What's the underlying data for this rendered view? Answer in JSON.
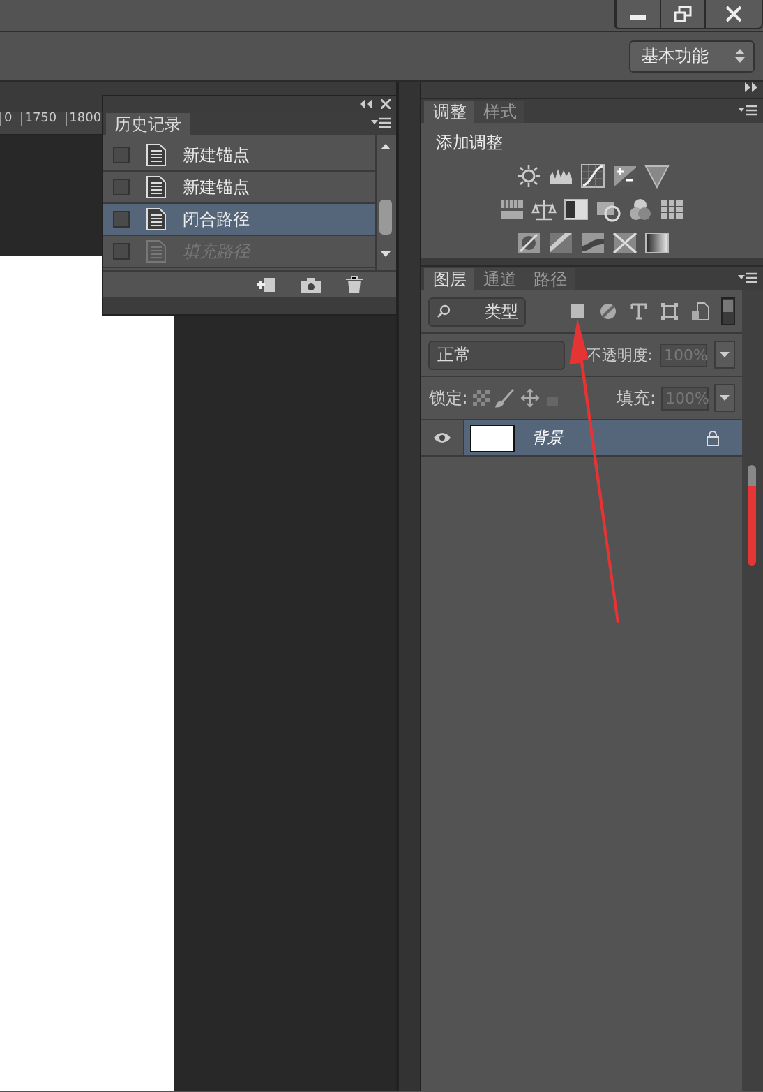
{
  "workspace_menu": {
    "value": "基本功能"
  },
  "ruler": {
    "labels": [
      "0",
      "1750",
      "1800"
    ]
  },
  "history": {
    "title": "历史记录",
    "items": [
      {
        "label": "新建锚点",
        "selected": false,
        "disabled": false
      },
      {
        "label": "新建锚点",
        "selected": false,
        "disabled": false
      },
      {
        "label": "闭合路径",
        "selected": true,
        "disabled": false
      },
      {
        "label": "填充路径",
        "selected": false,
        "disabled": true
      }
    ]
  },
  "adjustments": {
    "tabs": [
      {
        "label": "调整",
        "selected": true
      },
      {
        "label": "样式",
        "selected": false
      }
    ],
    "heading": "添加调整"
  },
  "layers": {
    "tabs": [
      {
        "label": "图层",
        "selected": true
      },
      {
        "label": "通道",
        "selected": false
      },
      {
        "label": "路径",
        "selected": false
      }
    ],
    "filter": "类型",
    "filter_enabled": true,
    "blend_mode": "正常",
    "opacity_label": "不透明度:",
    "opacity": "100%",
    "lock_label": "锁定:",
    "fill_label": "填充:",
    "fill": "100%",
    "items": [
      {
        "name": "背景",
        "selected": true
      }
    ]
  }
}
